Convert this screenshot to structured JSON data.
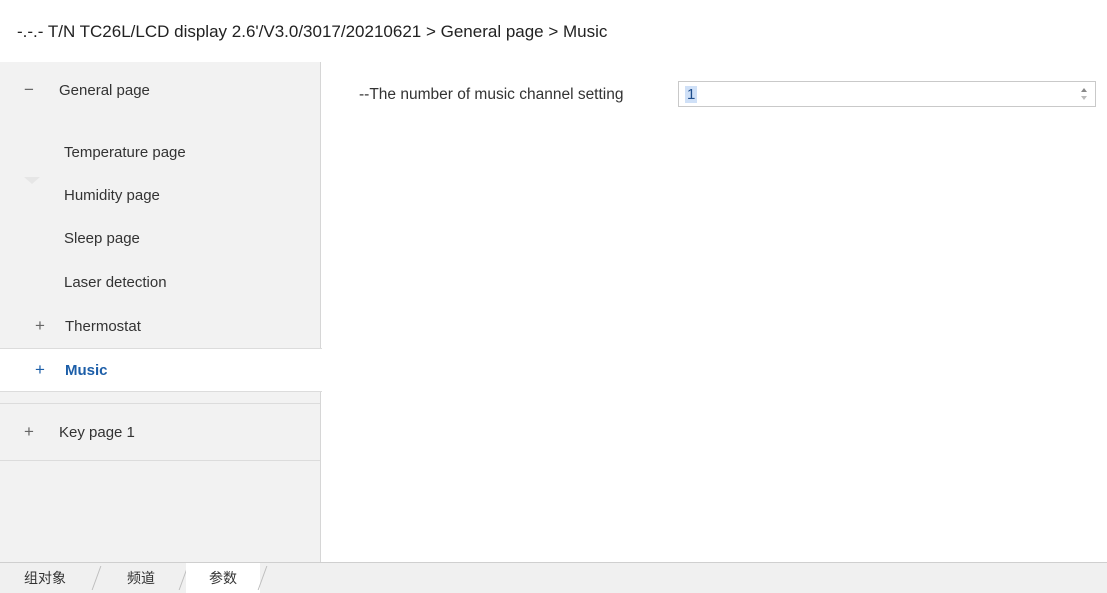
{
  "title": "-.-.- T/N TC26L/LCD display 2.6'/V3.0/3017/20210621 > General page > Music",
  "sidebar": {
    "items": [
      {
        "sign": "−",
        "label": "General page"
      },
      {
        "label": "Temperature page"
      },
      {
        "label": "Humidity page"
      },
      {
        "label": "Sleep page"
      },
      {
        "label": "Laser detection"
      },
      {
        "sign": "+",
        "label": "Thermostat"
      },
      {
        "sign": "+",
        "label": "Music"
      },
      {
        "sign": "+",
        "label": "Key page 1"
      }
    ]
  },
  "main": {
    "param_label": "--The number of music channel setting",
    "param_value": "1"
  },
  "tabs": [
    "组对象",
    "频道",
    "参数"
  ],
  "colors": {
    "selected_text": "#1c5ea8",
    "sidebar_bg": "#f2f2f2"
  }
}
